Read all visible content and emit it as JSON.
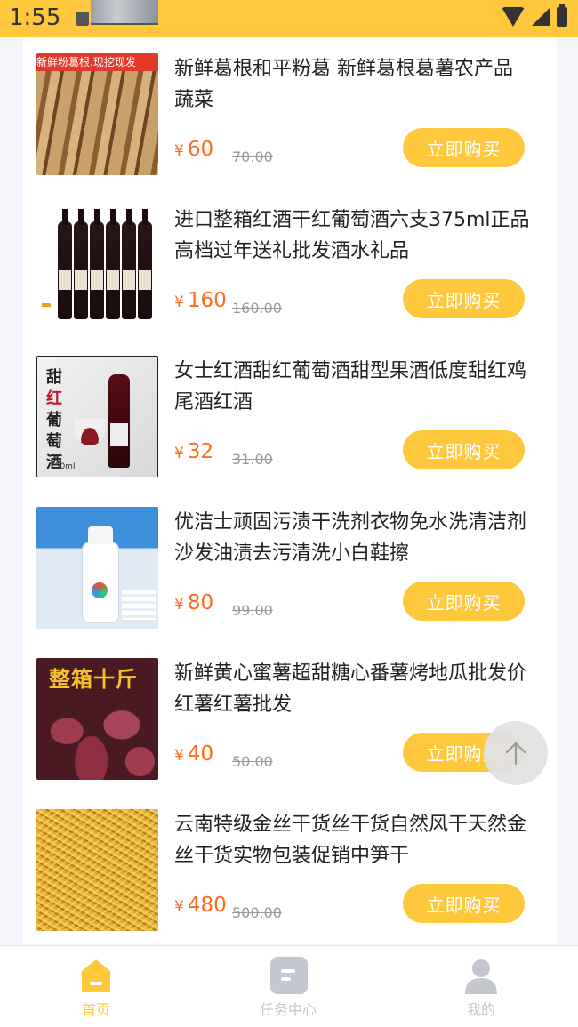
{
  "status_bar": {
    "time": "1:55"
  },
  "products": [
    {
      "title": "新鲜葛根和平粉葛 新鲜葛根葛薯农产品蔬菜",
      "currency": "¥",
      "price": "60",
      "original_price": "70.00",
      "buy_label": "立即购买",
      "image_tag": "新鲜粉葛根.现挖现发"
    },
    {
      "title": "进口整箱红酒干红葡萄酒六支375ml正品高档过年送礼批发酒水礼品",
      "currency": "¥",
      "price": "160",
      "original_price": "160.00",
      "buy_label": "立即购买"
    },
    {
      "title": "女士红酒甜红葡萄酒甜型果酒低度甜红鸡尾酒红酒",
      "currency": "¥",
      "price": "32",
      "original_price": "31.00",
      "buy_label": "立即购买",
      "image_tag_top": "甜",
      "image_tag_mid": "红",
      "image_tag_bottom": "葡萄酒",
      "image_volume": "750ml"
    },
    {
      "title": "优洁士顽固污渍干洗剂衣物免水洗清洁剂沙发油渍去污清洗小白鞋擦",
      "currency": "¥",
      "price": "80",
      "original_price": "99.00",
      "buy_label": "立即购买"
    },
    {
      "title": "新鲜黄心蜜薯超甜糖心番薯烤地瓜批发价红薯红薯批发",
      "currency": "¥",
      "price": "40",
      "original_price": "50.00",
      "buy_label": "立即购买",
      "image_tag": "整箱十斤"
    },
    {
      "title": "云南特级金丝干货丝干货自然风干天然金丝干货实物包装促销中笋干",
      "currency": "¥",
      "price": "480",
      "original_price": "500.00",
      "buy_label": "立即购买"
    }
  ],
  "nav": {
    "home": "首页",
    "tasks": "任务中心",
    "me": "我的"
  },
  "colors": {
    "accent": "#ffc73b",
    "price": "#ff6a1a",
    "nav_active": "#ffc73b",
    "nav_inactive": "#c4c7cf"
  }
}
